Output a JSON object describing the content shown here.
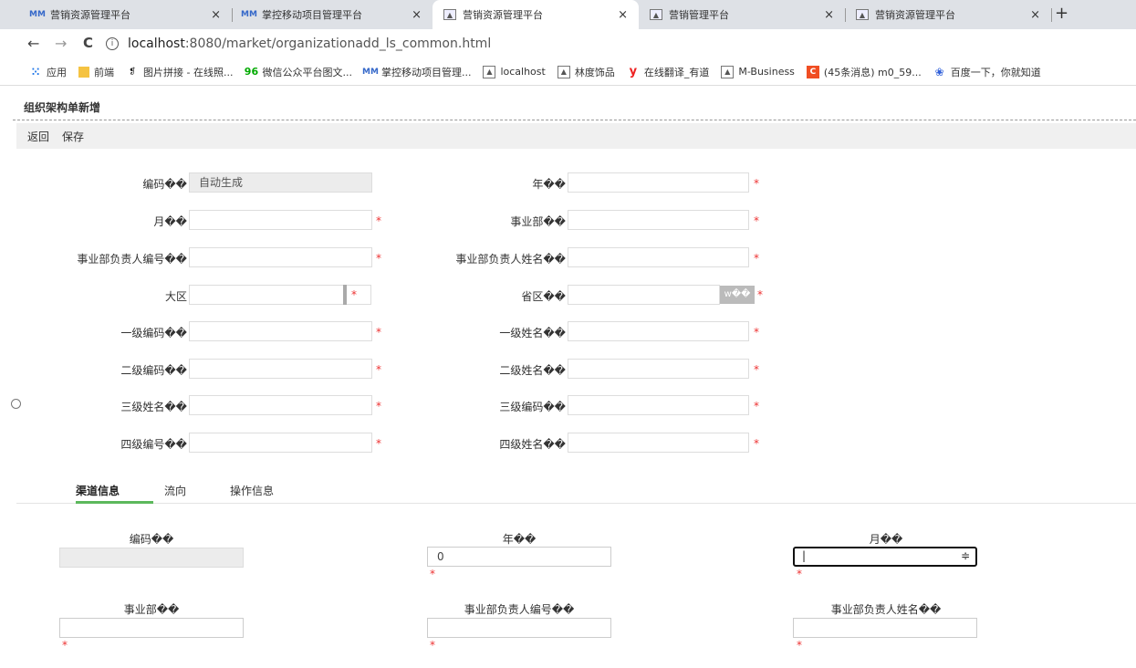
{
  "browser": {
    "tabs": [
      {
        "title": "营销资源管理平台",
        "icon": "MM"
      },
      {
        "title": "掌控移动项目管理平台",
        "icon": "MM"
      },
      {
        "title": "营销资源管理平台",
        "icon": "img"
      },
      {
        "title": "营销管理平台",
        "icon": "img"
      },
      {
        "title": "营销资源管理平台",
        "icon": "img"
      }
    ],
    "close_glyph": "×",
    "new_tab_glyph": "+",
    "url_host": "localhost",
    "url_rest": ":8080/market/organizationadd_ls_common.html",
    "back_glyph": "←",
    "forward_glyph": "→",
    "reload_glyph": "C",
    "info_glyph": "i"
  },
  "bookmarks": [
    {
      "label": "应用",
      "icon": "apps-grid"
    },
    {
      "label": "前端",
      "icon": "folder"
    },
    {
      "label": "图片拼接 - 在线照...",
      "icon": "pin"
    },
    {
      "label": "微信公众平台图文...",
      "icon": "96"
    },
    {
      "label": "掌控移动项目管理...",
      "icon": "MM"
    },
    {
      "label": "localhost",
      "icon": "img"
    },
    {
      "label": "林度饰品",
      "icon": "img"
    },
    {
      "label": "在线翻译_有道",
      "icon": "y"
    },
    {
      "label": "M-Business",
      "icon": "img"
    },
    {
      "label": "(45条消息) m0_59...",
      "icon": "C"
    },
    {
      "label": "百度一下，你就知道",
      "icon": "paw"
    }
  ],
  "page": {
    "title": "组织架构单新增",
    "actions": {
      "back": "返回",
      "save": "保存"
    }
  },
  "form": {
    "code_label": "编码��",
    "code_value": "自动生成",
    "year_label": "年��",
    "month_label": "月��",
    "division_label": "事业部��",
    "division_head_code_label": "事业部负责人编号��",
    "division_head_name_label": "事业部负责人姓名��",
    "region_label": "大区",
    "province_label": "省区��",
    "province_tag": "w��",
    "level1_code_label": "一级编码��",
    "level1_name_label": "一级姓名��",
    "level2_code_label": "二级编码��",
    "level2_name_label": "二级姓名��",
    "level3_name_label": "三级姓名��",
    "level3_code_label": "三级编码��",
    "level4_code_label": "四级编号��",
    "level4_name_label": "四级姓名��",
    "required_mark": "*"
  },
  "subtabs": {
    "channel": "渠道信息",
    "flow": "流向",
    "operation": "操作信息"
  },
  "channel": {
    "code_label": "编码��",
    "year_label": "年��",
    "year_value": "0",
    "month_label": "月��",
    "month_value": "|",
    "select_glyph": "≑",
    "division_label": "事业部��",
    "head_code_label": "事业部负责人编号��",
    "head_name_label": "事业部负责人姓名��"
  },
  "colors": {
    "accent": "#5cb85c",
    "required": "#ee3333"
  }
}
